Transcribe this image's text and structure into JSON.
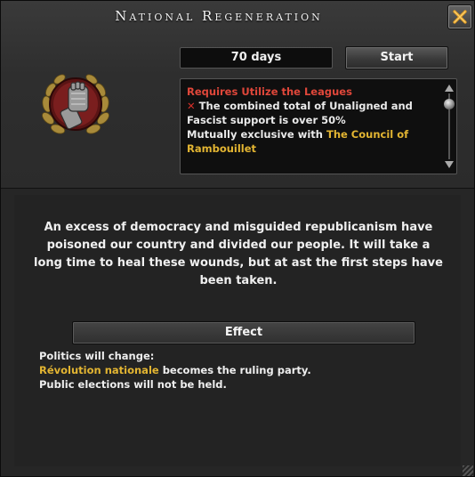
{
  "window": {
    "title": "National Regeneration",
    "close_icon": "close-x-icon"
  },
  "focus": {
    "icon": "fist-laurel-emblem-icon",
    "duration": "70 days",
    "start_label": "Start"
  },
  "requirements": {
    "heading": "Requires Utilize the Leagues",
    "fail_mark": "✕",
    "line1": "The combined total of Unaligned and Fascist support is over 50%",
    "exclusive_prefix": "Mutually exclusive with ",
    "exclusive_target": "The Council of Rambouillet"
  },
  "description": "An excess of democracy and misguided republicanism have poisoned our country and divided our people. It will take a long time to heal these wounds, but at ast the first steps have been taken.",
  "effect": {
    "header": "Effect",
    "line1": "Politics will change:",
    "party": "Révolution nationale",
    "line2_suffix": " becomes the ruling party.",
    "line3": "Public elections will not be held."
  },
  "colors": {
    "requirement_red": "#e0473a",
    "highlight_gold": "#e3b532"
  }
}
